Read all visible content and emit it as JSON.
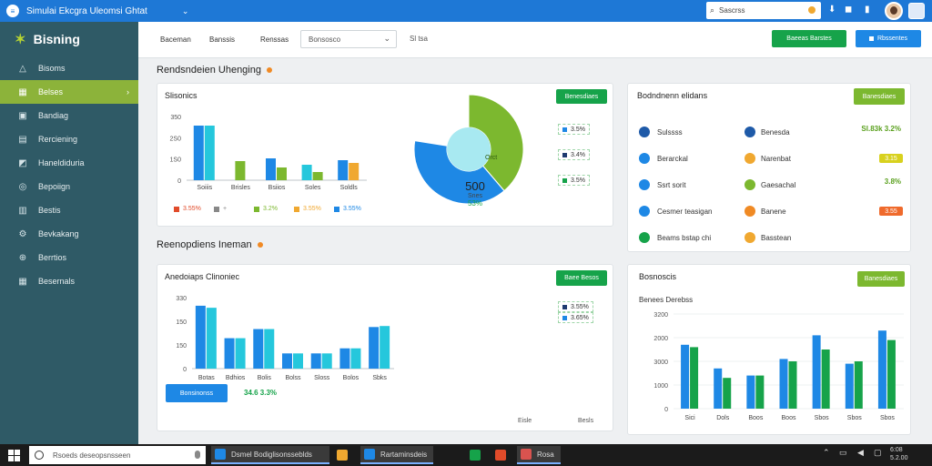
{
  "topbar": {
    "title": "Simulai Ekcgra Uleomsi Ghtat",
    "search_placeholder": "Sascrss",
    "chevron": "⌄"
  },
  "brand": {
    "name": "Bisning"
  },
  "sidebar": {
    "items": [
      {
        "label": "Bisoms",
        "icon": "triangle-icon"
      },
      {
        "label": "Belses",
        "icon": "grid-icon",
        "active": true
      },
      {
        "label": "Bandiag",
        "icon": "box-icon"
      },
      {
        "label": "Rerciening",
        "icon": "report-icon"
      },
      {
        "label": "Haneldiduria",
        "icon": "chart-icon"
      },
      {
        "label": "Bepoiign",
        "icon": "circle-icon"
      },
      {
        "label": "Bestis",
        "icon": "table-icon"
      },
      {
        "label": "Bevkakang",
        "icon": "wrench-icon"
      },
      {
        "label": "Berrtios",
        "icon": "globe-icon"
      },
      {
        "label": "Besernals",
        "icon": "grid-icon"
      }
    ]
  },
  "toolbar": {
    "tabs": [
      "Baceman",
      "Banssis",
      "Renssas"
    ],
    "select_value": "Bonsosco",
    "extra": "Sl  tsa",
    "btn_primary": "Baeeas Barstes",
    "btn_secondary": "Rbssentes"
  },
  "sections": {
    "top": "Rendsndeien Uhenging",
    "bottom": "Reenopdiens Ineman"
  },
  "card1": {
    "title": "Slisonics",
    "button": "Benesdiaes",
    "legend": [
      {
        "label": "3.55%",
        "color": "#e14b2a"
      },
      {
        "label": "+",
        "color": "#888888"
      },
      {
        "label": "3.2%",
        "color": "#7cb82f"
      },
      {
        "label": "3.55%",
        "color": "#f0a830"
      },
      {
        "label": "3.55%",
        "color": "#1e88e5"
      }
    ],
    "side_tags": [
      {
        "label": "3.5%",
        "color": "#1e88e5"
      },
      {
        "label": "3.4%",
        "color": "#1e3a70"
      },
      {
        "label": "3.5%",
        "color": "#16a34a"
      }
    ],
    "donut": {
      "value": "500",
      "sub": "Snes",
      "pct": "53%",
      "inner": "Orct"
    }
  },
  "card2": {
    "title": "Bodndnenn elidans",
    "button": "Banesdiaes",
    "rows": [
      {
        "left": "Sulssss",
        "left_color": "#1e5aa8",
        "right": "Benesda",
        "right_color": "#1e5aa8",
        "value": "Sl.83k 3.2%",
        "value_color": "#5aa01e"
      },
      {
        "left": "Berarckal",
        "left_color": "#1e88e5",
        "right": "Narenbat",
        "right_color": "#f0a830",
        "badge": "3.15",
        "badge_color": "#d8d11e"
      },
      {
        "left": "Ssrt sorit",
        "left_color": "#1e88e5",
        "right": "Gaesachal",
        "right_color": "#7cb82f",
        "value": "3.8%",
        "value_color": "#5aa01e"
      },
      {
        "left": "Cesmer teasigan",
        "left_color": "#1e88e5",
        "right": "Banene",
        "right_color": "#f08a24",
        "badge": "3.55",
        "badge_color": "#ef6a2c"
      },
      {
        "left": "Beams bstap chi",
        "left_color": "#16a34a",
        "right": "Basstean",
        "right_color": "#f0a830"
      }
    ]
  },
  "card3": {
    "title": "Anedoiaps Clinoniec",
    "button": "Baee Besos",
    "tags": [
      {
        "label": "3.55%",
        "color": "#1e3a70"
      },
      {
        "label": "3.65%",
        "color": "#1e88e5"
      }
    ],
    "action_btn": "Bonsinonss",
    "metric": "34.6 3.3%",
    "foot": [
      "Eisle",
      "Besls"
    ]
  },
  "card4": {
    "title": "Bosnoscis",
    "subtitle": "Benees Derebss",
    "button": "Banesdiaes"
  },
  "taskbar": {
    "search_placeholder": "Rsoeds deseopsnsseen",
    "apps": [
      {
        "label": "Dsmel Bodiglisonsseblds",
        "color": "#1e88e5"
      },
      {
        "label": "",
        "color": "#f0a830"
      },
      {
        "label": "Rartaminsdeis",
        "color": "#1e88e5"
      },
      {
        "label": "",
        "color": "#16a34a"
      },
      {
        "label": "",
        "color": "#e14b2a"
      },
      {
        "label": "Rosa",
        "color": "#d9534f"
      }
    ],
    "clock": "6:08\n5.2.00"
  },
  "chart_data": [
    {
      "type": "bar",
      "title": "Slisonics",
      "ylim": [
        0,
        350
      ],
      "yticks": [
        "0",
        "1S0",
        "2S0",
        "350"
      ],
      "categories": [
        "Soiiis",
        "Brisles",
        "Bsiios",
        "Soles",
        "Soldls"
      ],
      "series": [
        {
          "name": "",
          "color": "#1e88e5",
          "values": [
            300,
            0,
            120,
            0,
            110
          ]
        },
        {
          "name": "",
          "color": "#25c7dc",
          "values": [
            300,
            0,
            0,
            85,
            0
          ]
        },
        {
          "name": "",
          "color": "#7cb82f",
          "values": [
            0,
            105,
            0,
            0,
            0
          ]
        },
        {
          "name": "",
          "color": "#7cb82f",
          "values": [
            0,
            0,
            70,
            45,
            0
          ]
        },
        {
          "name": "",
          "color": "#f0a830",
          "values": [
            0,
            0,
            0,
            0,
            95
          ]
        }
      ]
    },
    {
      "type": "pie",
      "title": "",
      "slices": [
        {
          "label": "",
          "value": 50,
          "color": "#7cb82f"
        },
        {
          "label": "",
          "value": 50,
          "color": "#1e88e5"
        }
      ]
    },
    {
      "type": "bar",
      "title": "Anedoiaps Clinoniec",
      "ylim": [
        0,
        350
      ],
      "yticks": [
        "0",
        "150",
        "150",
        "330"
      ],
      "categories": [
        "Botas",
        "Bdhios",
        "Bolis",
        "Bolss",
        "Sloss",
        "Bolos",
        "Sbks"
      ],
      "series": [
        {
          "name": "",
          "color": "#1e88e5",
          "values": [
            310,
            150,
            195,
            75,
            75,
            100,
            205
          ]
        },
        {
          "name": "",
          "color": "#25c7dc",
          "values": [
            300,
            150,
            195,
            75,
            75,
            100,
            210
          ]
        }
      ]
    },
    {
      "type": "bar",
      "title": "Bosnoscis",
      "ylim": [
        0,
        4000
      ],
      "yticks": [
        "0",
        "1000",
        "3000",
        "2000",
        "3200"
      ],
      "categories": [
        "Sici",
        "Dols",
        "Boos",
        "Boos",
        "Sbos",
        "Sbos",
        "Sbos"
      ],
      "series": [
        {
          "name": "",
          "color": "#1e88e5",
          "values": [
            2700,
            1700,
            1400,
            2100,
            3100,
            1900,
            3300
          ]
        },
        {
          "name": "",
          "color": "#16a34a",
          "values": [
            2600,
            1300,
            1400,
            2000,
            2500,
            2000,
            2900
          ]
        }
      ]
    }
  ]
}
